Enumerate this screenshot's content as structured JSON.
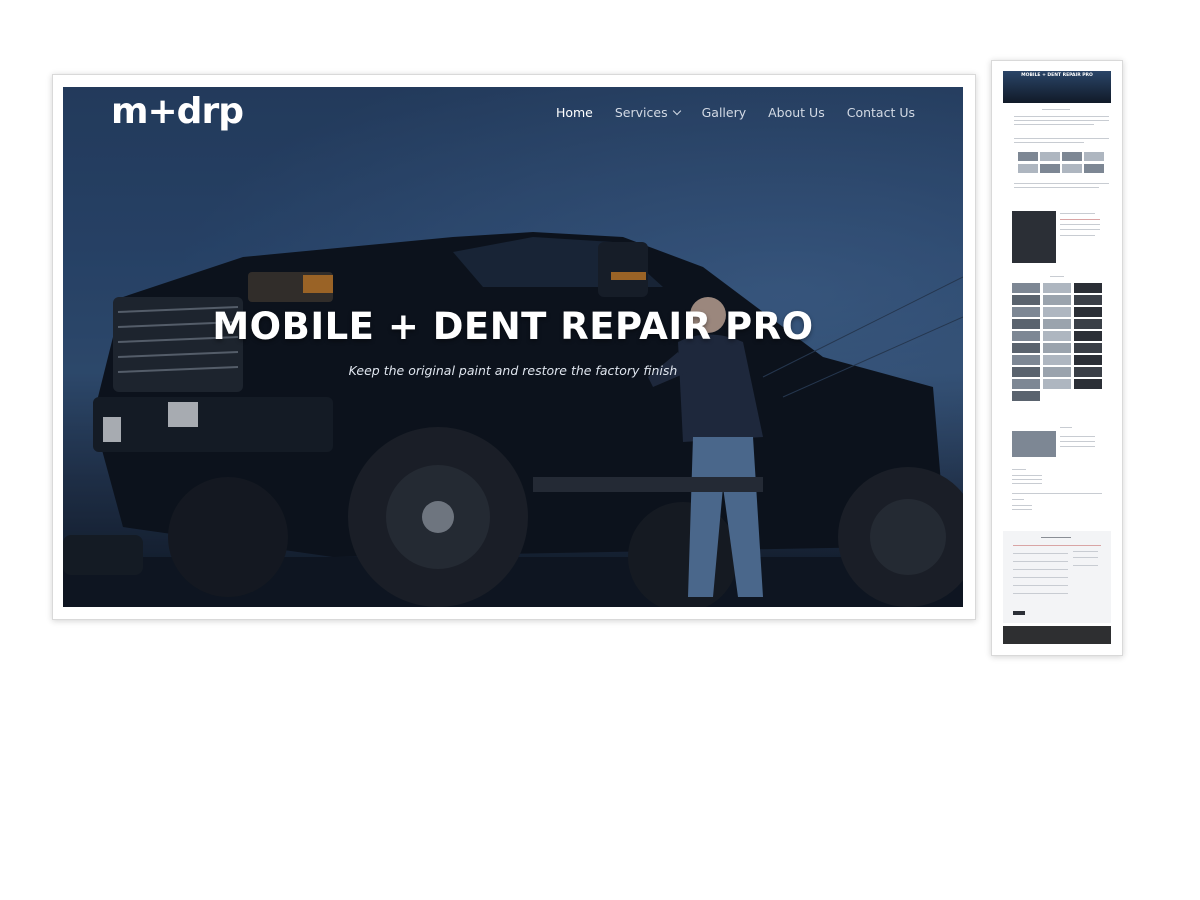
{
  "logo": {
    "text": "m+drp"
  },
  "nav": {
    "items": [
      {
        "label": "Home",
        "active": true,
        "dropdown": false
      },
      {
        "label": "Services",
        "active": false,
        "dropdown": true
      },
      {
        "label": "Gallery",
        "active": false,
        "dropdown": false
      },
      {
        "label": "About Us",
        "active": false,
        "dropdown": false
      },
      {
        "label": "Contact Us",
        "active": false,
        "dropdown": false
      }
    ]
  },
  "hero": {
    "title": "MOBILE + DENT REPAIR PRO",
    "subtitle": "Keep the original paint and restore the factory finish"
  },
  "thumbnail": {
    "hero_title": "MOBILE + DENT REPAIR PRO"
  },
  "colors": {
    "hero_overlay": "#284266",
    "nav_text": "#d3dae5",
    "nav_active": "#ffffff"
  }
}
